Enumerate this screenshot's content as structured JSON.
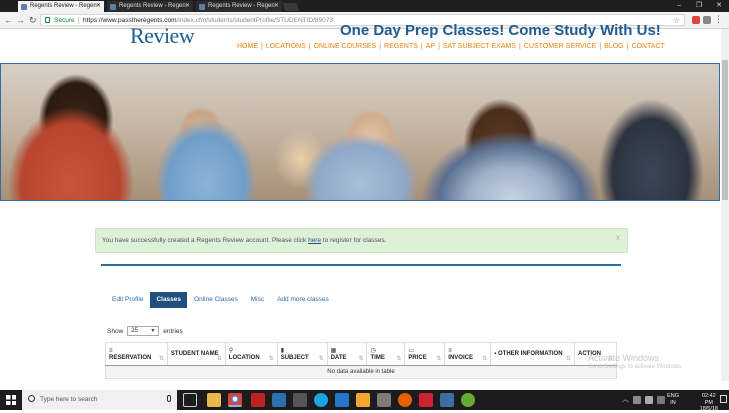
{
  "browser": {
    "tabs": [
      {
        "label": "Regents Review - Regen"
      },
      {
        "label": "Regents Review - Regen"
      },
      {
        "label": "Regents Review - Regen"
      }
    ],
    "secure_label": "Secure",
    "url_host": "https://www.passtheregents.com",
    "url_path": "/index.cfm/students/studentProfile/STUDENTID/89073"
  },
  "site": {
    "logo": "Review",
    "headline": "One Day Prep Classes! Come Study With Us!",
    "nav": [
      "HOME",
      "LOCATIONS",
      "ONLINE COURSES",
      "REGENTS",
      "AP",
      "SAT SUBJECT EXAMS",
      "CUSTOMER SERVICE",
      "BLOG",
      "CONTACT"
    ]
  },
  "alert": {
    "text_before": "You have successfully created a Regents Review account. Please click ",
    "link": "here",
    "text_after": " to register for classes.",
    "close": "x"
  },
  "profile_tabs": [
    {
      "label": "Edit Profile",
      "active": false
    },
    {
      "label": "Classes",
      "active": true
    },
    {
      "label": "Online Classes",
      "active": false
    },
    {
      "label": "Misc",
      "active": false
    },
    {
      "label": "Add more classes",
      "active": false
    }
  ],
  "table": {
    "show_label": "Show",
    "page_size": "25",
    "entries_label": "entries",
    "columns": [
      {
        "icon": "≡",
        "label": "RESERVATION"
      },
      {
        "icon": "",
        "label": "STUDENT NAME"
      },
      {
        "icon": "⚲",
        "label": "LOCATION"
      },
      {
        "icon": "▮",
        "label": "SUBJECT"
      },
      {
        "icon": "▦",
        "label": "DATE"
      },
      {
        "icon": "◷",
        "label": "TIME"
      },
      {
        "icon": "▭",
        "label": "PRICE"
      },
      {
        "icon": "≡",
        "label": "INVOICE"
      },
      {
        "icon": "",
        "label": "▪ OTHER INFORMATION"
      },
      {
        "icon": "",
        "label": "ACTION"
      }
    ],
    "empty_message": "No data available in table"
  },
  "watermark": {
    "line1": "Activate Windows",
    "line2": "Go to Settings to activate Windows."
  },
  "taskbar": {
    "search_placeholder": "Type here to search",
    "lang": "ENG",
    "region": "IN",
    "time": "02:42 PM",
    "date": "18/5/18"
  }
}
